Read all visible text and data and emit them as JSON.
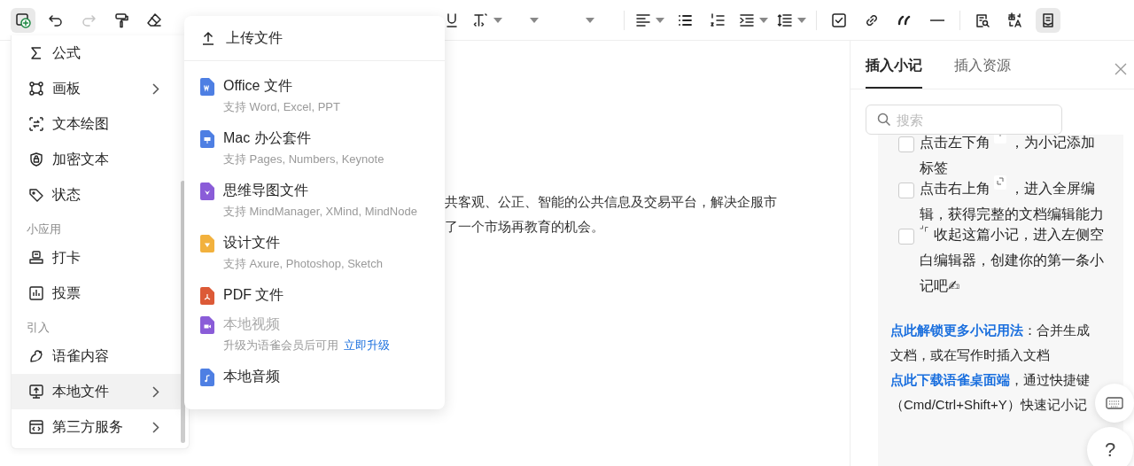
{
  "toolbar": {
    "groups": [
      [
        {
          "kind": "insert",
          "selected": true,
          "disabled": false
        },
        {
          "kind": "undo",
          "selected": false,
          "disabled": false
        },
        {
          "kind": "redo",
          "selected": false,
          "disabled": true
        },
        {
          "kind": "painter",
          "selected": false,
          "disabled": false
        },
        {
          "kind": "eraser",
          "selected": false,
          "disabled": false
        }
      ],
      [
        {
          "kind": "underline",
          "selected": false,
          "disabled": false
        },
        {
          "kind": "fontsize",
          "selected": false,
          "disabled": false
        },
        {
          "kind": "dropdown",
          "selected": false,
          "disabled": false
        },
        {
          "kind": "dropdown",
          "selected": false,
          "disabled": false
        }
      ],
      [
        {
          "kind": "align",
          "selected": false,
          "disabled": false
        },
        {
          "kind": "bullets",
          "selected": false,
          "disabled": false
        },
        {
          "kind": "ordered",
          "selected": false,
          "disabled": false
        },
        {
          "kind": "indent",
          "selected": false,
          "disabled": false
        },
        {
          "kind": "lineheight",
          "selected": false,
          "disabled": false
        }
      ],
      [
        {
          "kind": "task",
          "selected": false,
          "disabled": false
        },
        {
          "kind": "link",
          "selected": false,
          "disabled": false
        },
        {
          "kind": "quote",
          "selected": false,
          "disabled": false
        },
        {
          "kind": "rule",
          "selected": false,
          "disabled": false
        }
      ],
      [
        {
          "kind": "find",
          "selected": false,
          "disabled": false
        },
        {
          "kind": "translate",
          "selected": false,
          "disabled": false
        },
        {
          "kind": "notes",
          "selected": true,
          "disabled": false
        }
      ]
    ]
  },
  "document": {
    "lines": [
      "共客观、公正、智能的公共信息及交易平台，解决企服市",
      "了一个市场再教育的机会。"
    ]
  },
  "insert_menu": {
    "items": [
      {
        "kind": "formula",
        "label": "公式",
        "has_submenu": false,
        "selected": false
      },
      {
        "kind": "board",
        "label": "画板",
        "has_submenu": true,
        "selected": false
      },
      {
        "kind": "text-diagram",
        "label": "文本绘图",
        "has_submenu": false,
        "selected": false
      },
      {
        "kind": "encrypted",
        "label": "加密文本",
        "has_submenu": false,
        "selected": false
      },
      {
        "kind": "status",
        "label": "状态",
        "has_submenu": false,
        "selected": false
      },
      {
        "kind": "section",
        "label": "小应用"
      },
      {
        "kind": "checkin",
        "label": "打卡",
        "has_submenu": false,
        "selected": false
      },
      {
        "kind": "vote",
        "label": "投票",
        "has_submenu": false,
        "selected": false
      },
      {
        "kind": "section",
        "label": "引入"
      },
      {
        "kind": "yuque",
        "label": "语雀内容",
        "has_submenu": false,
        "selected": false
      },
      {
        "kind": "local-file",
        "label": "本地文件",
        "has_submenu": true,
        "selected": true
      },
      {
        "kind": "third-party",
        "label": "第三方服务",
        "has_submenu": true,
        "selected": false
      }
    ]
  },
  "file_menu": {
    "header": "上传文件",
    "items": [
      {
        "kind": "office",
        "label": "Office 文件",
        "hint": "支持 Word, Excel, PPT",
        "color": "#4e7fe3",
        "disabled": false
      },
      {
        "kind": "mac",
        "label": "Mac 办公套件",
        "hint": "支持 Pages, Numbers, Keynote",
        "color": "#4e7fe3",
        "disabled": false
      },
      {
        "kind": "mindmap",
        "label": "思维导图文件",
        "hint": "支持 MindManager, XMind, MindNode",
        "color": "#8a5cd8",
        "disabled": false
      },
      {
        "kind": "design",
        "label": "设计文件",
        "hint": "支持 Axure, Photoshop, Sketch",
        "color": "#f2b13d",
        "disabled": false
      },
      {
        "kind": "pdf",
        "label": "PDF 文件",
        "color": "#dc5a37",
        "disabled": false
      },
      {
        "kind": "video",
        "label": "本地视频",
        "hint": "升级为语雀会员后可用",
        "link": "立即升级",
        "color": "#8a5cd8",
        "disabled": true
      },
      {
        "kind": "audio",
        "label": "本地音频",
        "color": "#4e7fe3",
        "disabled": false
      }
    ]
  },
  "notes_panel": {
    "tabs": [
      {
        "label": "插入小记",
        "selected": true
      },
      {
        "label": "插入资源",
        "selected": false
      }
    ],
    "search": {
      "placeholder": "搜索"
    },
    "tasks": [
      {
        "checked": false,
        "before": "点击左下角",
        "kind": "plus",
        "after": "，为小记添加标签"
      },
      {
        "checked": false,
        "before": "点击右上角",
        "kind": "expand",
        "after": "，进入全屏编辑，获得完整的文档编辑能力"
      },
      {
        "checked": false,
        "kind": "collapse",
        "after": "收起这篇小记，进入左侧空白编辑器，创建你的第一条小记吧✍"
      }
    ],
    "tips": [
      {
        "link": "点此解锁更多小记用法",
        "text": "：合并生成文档，或在写作时插入文档"
      },
      {
        "link": "点此下载语雀桌面端",
        "text": "，通过快捷键（Cmd/Ctrl+Shift+Y）快速记小记"
      }
    ]
  },
  "help_button": {
    "label": "?"
  }
}
